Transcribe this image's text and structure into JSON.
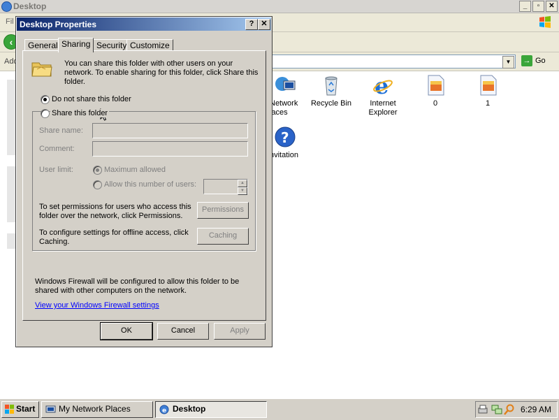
{
  "explorer": {
    "title": "Desktop",
    "menu_partial": "Fil",
    "address_label": "Add",
    "go_label": "Go",
    "desktop_icons": [
      {
        "label": "Network\nlaces",
        "icon": "network-places-icon"
      },
      {
        "label": "Recycle Bin",
        "icon": "recycle-bin-icon"
      },
      {
        "label": "Internet\nExplorer",
        "icon": "internet-explorer-icon"
      },
      {
        "label": "0",
        "icon": "image-file-icon"
      },
      {
        "label": "1",
        "icon": "image-file-icon"
      },
      {
        "label": "nvitation",
        "icon": "help-invitation-icon"
      }
    ]
  },
  "dialog": {
    "title": "Desktop Properties",
    "help_label": "?",
    "close_label": "✕",
    "tabs": [
      {
        "label": "General",
        "active": false
      },
      {
        "label": "Sharing",
        "active": true
      },
      {
        "label": "Security",
        "active": false
      },
      {
        "label": "Customize",
        "active": false
      }
    ],
    "intro": "You can share this folder with other users on your network.  To enable sharing for this folder, click Share this folder.",
    "radio_no_share": "Do not share this folder",
    "radio_share": "Share this folder",
    "share_name_label": "Share name:",
    "share_name_value": "",
    "comment_label": "Comment:",
    "comment_value": "",
    "user_limit_label": "User limit:",
    "max_allowed_label": "Maximum allowed",
    "allow_number_label": "Allow this number of users:",
    "allow_number_value": "",
    "permissions_text": "To set permissions for users who access this folder over the network, click Permissions.",
    "permissions_button": "Permissions",
    "caching_text": "To configure settings for offline access, click Caching.",
    "caching_button": "Caching",
    "firewall_text": "Windows Firewall will be configured to allow this folder to be shared with other computers on the network.",
    "firewall_link": "View your Windows Firewall settings",
    "ok_button": "OK",
    "cancel_button": "Cancel",
    "apply_button": "Apply"
  },
  "taskbar": {
    "start_label": "Start",
    "tasks": [
      {
        "label": "My Network Places",
        "active": false
      },
      {
        "label": "Desktop",
        "active": true
      }
    ],
    "clock": "6:29 AM"
  }
}
